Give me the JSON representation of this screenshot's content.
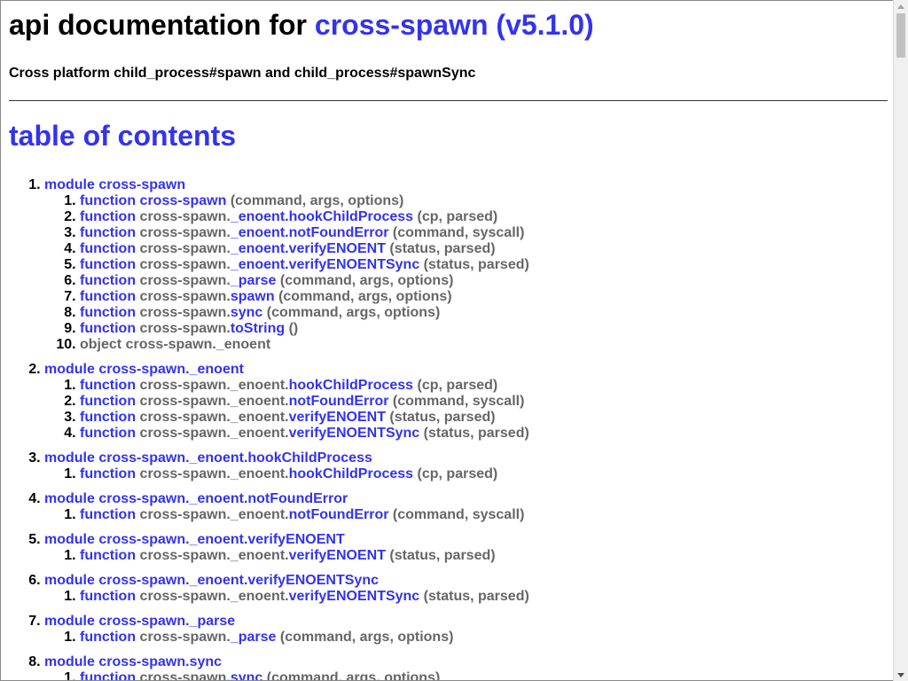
{
  "header": {
    "title_prefix": "api documentation for ",
    "package_link": "cross-spawn (v5.1.0)",
    "description": "Cross platform child_process#spawn and child_process#spawnSync"
  },
  "toc_title": "table of contents",
  "modules": [
    {
      "label": "module cross-spawn",
      "items": [
        {
          "kind": "function",
          "prefix": "cross-spawn",
          "name": "",
          "args": "(command, args, options)",
          "style": "all-blue"
        },
        {
          "kind": "function",
          "prefix": "cross-spawn.",
          "name": "_enoent.hookChildProcess",
          "args": "(cp, parsed)",
          "style": "prefix-grey"
        },
        {
          "kind": "function",
          "prefix": "cross-spawn.",
          "name": "_enoent.notFoundError",
          "args": "(command, syscall)",
          "style": "prefix-grey"
        },
        {
          "kind": "function",
          "prefix": "cross-spawn.",
          "name": "_enoent.verifyENOENT",
          "args": "(status, parsed)",
          "style": "prefix-grey"
        },
        {
          "kind": "function",
          "prefix": "cross-spawn.",
          "name": "_enoent.verifyENOENTSync",
          "args": "(status, parsed)",
          "style": "prefix-grey"
        },
        {
          "kind": "function",
          "prefix": "cross-spawn.",
          "name": "_parse",
          "args": "(command, args, options)",
          "style": "prefix-grey"
        },
        {
          "kind": "function",
          "prefix": "cross-spawn.",
          "name": "spawn",
          "args": "(command, args, options)",
          "style": "prefix-grey"
        },
        {
          "kind": "function",
          "prefix": "cross-spawn.",
          "name": "sync",
          "args": "(command, args, options)",
          "style": "prefix-grey"
        },
        {
          "kind": "function",
          "prefix": "cross-spawn.",
          "name": "toString",
          "args": "()",
          "style": "prefix-grey"
        },
        {
          "kind": "object",
          "prefix": "object cross-spawn._enoent",
          "name": "",
          "args": "",
          "style": "object"
        }
      ]
    },
    {
      "label": "module cross-spawn._enoent",
      "items": [
        {
          "kind": "function",
          "prefix": "cross-spawn._enoent.",
          "name": "hookChildProcess",
          "args": "(cp, parsed)",
          "style": "prefix-grey"
        },
        {
          "kind": "function",
          "prefix": "cross-spawn._enoent.",
          "name": "notFoundError",
          "args": "(command, syscall)",
          "style": "prefix-grey"
        },
        {
          "kind": "function",
          "prefix": "cross-spawn._enoent.",
          "name": "verifyENOENT",
          "args": "(status, parsed)",
          "style": "prefix-grey"
        },
        {
          "kind": "function",
          "prefix": "cross-spawn._enoent.",
          "name": "verifyENOENTSync",
          "args": "(status, parsed)",
          "style": "prefix-grey"
        }
      ]
    },
    {
      "label": "module cross-spawn._enoent.hookChildProcess",
      "items": [
        {
          "kind": "function",
          "prefix": "cross-spawn._enoent.",
          "name": "hookChildProcess",
          "args": "(cp, parsed)",
          "style": "prefix-grey"
        }
      ]
    },
    {
      "label": "module cross-spawn._enoent.notFoundError",
      "items": [
        {
          "kind": "function",
          "prefix": "cross-spawn._enoent.",
          "name": "notFoundError",
          "args": "(command, syscall)",
          "style": "prefix-grey"
        }
      ]
    },
    {
      "label": "module cross-spawn._enoent.verifyENOENT",
      "items": [
        {
          "kind": "function",
          "prefix": "cross-spawn._enoent.",
          "name": "verifyENOENT",
          "args": "(status, parsed)",
          "style": "prefix-grey"
        }
      ]
    },
    {
      "label": "module cross-spawn._enoent.verifyENOENTSync",
      "items": [
        {
          "kind": "function",
          "prefix": "cross-spawn._enoent.",
          "name": "verifyENOENTSync",
          "args": "(status, parsed)",
          "style": "prefix-grey"
        }
      ]
    },
    {
      "label": "module cross-spawn._parse",
      "items": [
        {
          "kind": "function",
          "prefix": "cross-spawn.",
          "name": "_parse",
          "args": "(command, args, options)",
          "style": "prefix-grey"
        }
      ]
    },
    {
      "label": "module cross-spawn.sync",
      "items": [
        {
          "kind": "function",
          "prefix": "cross-spawn.",
          "name": "sync",
          "args": "(command, args, options)",
          "style": "prefix-grey"
        }
      ]
    }
  ],
  "colors": {
    "link": "#3333ee",
    "muted": "#666666",
    "text": "#000000"
  },
  "icons": {
    "scroll_up": "triangle-up-icon",
    "scroll_down": "triangle-down-icon"
  }
}
